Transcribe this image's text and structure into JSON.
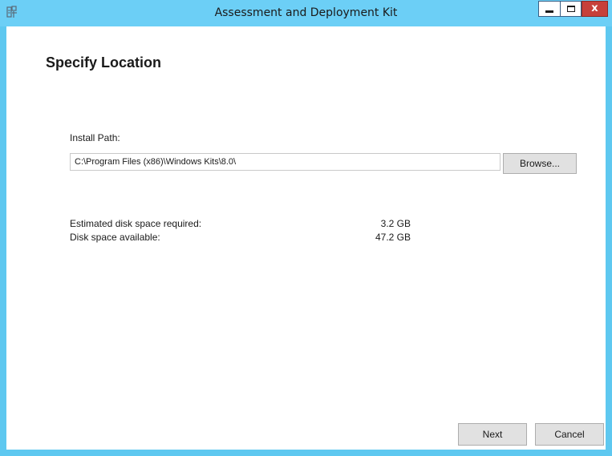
{
  "window": {
    "title": "Assessment and Deployment Kit",
    "icon": "setup-icon",
    "controls": {
      "minimize": "minimize-icon",
      "maximize": "maximize-icon",
      "close": "x"
    }
  },
  "page": {
    "heading": "Specify Location",
    "install_path_label": "Install Path:",
    "install_path_value": "C:\\Program Files (x86)\\Windows Kits\\8.0\\",
    "browse_label": "Browse...",
    "disk": {
      "required_label": "Estimated disk space required:",
      "required_value": "3.2 GB",
      "available_label": "Disk space available:",
      "available_value": "47.2 GB"
    }
  },
  "footer": {
    "next_label": "Next",
    "cancel_label": "Cancel"
  },
  "colors": {
    "titlebar": "#6ccff6",
    "close_button": "#c7403a",
    "button_face": "#e1e1e1"
  }
}
